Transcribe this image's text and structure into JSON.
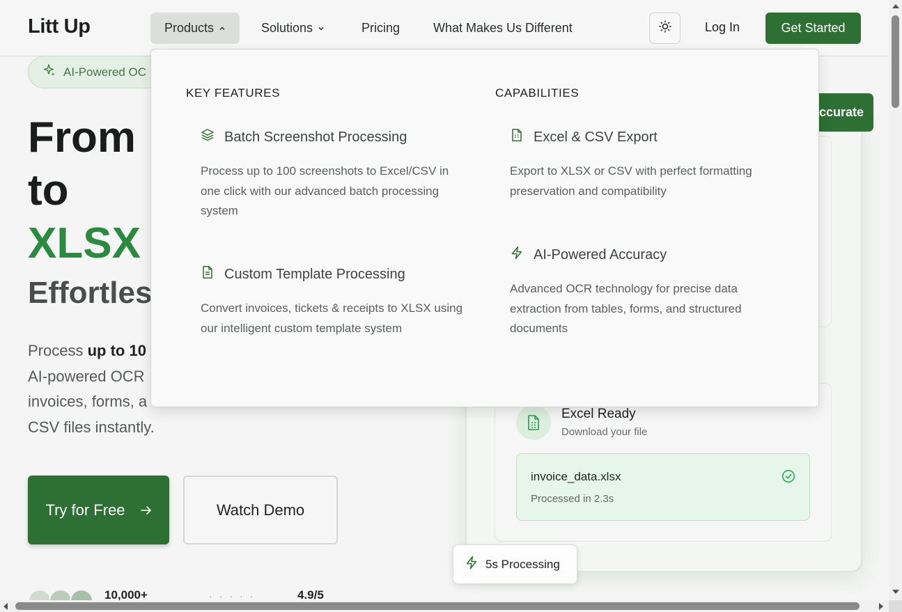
{
  "header": {
    "logo": "Litt Up",
    "nav": [
      {
        "label": "Products"
      },
      {
        "label": "Solutions"
      },
      {
        "label": "Pricing"
      },
      {
        "label": "What Makes Us Different"
      }
    ],
    "login": "Log In",
    "get_started": "Get Started",
    "theme_icon": "sun-icon"
  },
  "hero": {
    "badge": "AI-Powered OC",
    "title_line1": "From I",
    "title_line2": "to",
    "title_line3": "XLSX I",
    "subtitle": "Effortles",
    "desc_prefix": "Process ",
    "desc_bold": "up to 10",
    "desc_line2": "AI-powered OCR",
    "desc_line3": "invoices, forms, a",
    "desc_line4": "CSV files instantly.",
    "try_free": "Try for Free",
    "watch_demo": "Watch Demo",
    "users_stat": "10,000+",
    "rating": "4.9/5"
  },
  "preview": {
    "accurate_label": "ccurate",
    "excel_title": "Excel Ready",
    "excel_sub": "Download your file",
    "file_name": "invoice_data.xlsx",
    "file_time": "Processed in 2.3s",
    "processing": "5s Processing"
  },
  "dropdown": {
    "key_features_heading": "KEY FEATURES",
    "capabilities_heading": "CAPABILITIES",
    "features": [
      {
        "title": "Batch Screenshot Processing",
        "desc": "Process up to 100 screenshots to Excel/CSV in one click with our advanced batch processing system",
        "icon": "layers-icon"
      },
      {
        "title": "Custom Template Processing",
        "desc": "Convert invoices, tickets & receipts to XLSX using our intelligent custom template system",
        "icon": "file-text-icon"
      }
    ],
    "capabilities": [
      {
        "title": "Excel & CSV Export",
        "desc": "Export to XLSX or CSV with perfect formatting preservation and compatibility",
        "icon": "spreadsheet-icon"
      },
      {
        "title": "AI-Powered Accuracy",
        "desc": "Advanced OCR technology for precise data extraction from tables, forms, and structured documents",
        "icon": "lightning-icon"
      }
    ]
  },
  "colors": {
    "brand_green": "#2e6f33",
    "accent_green": "#2a8a3e"
  }
}
